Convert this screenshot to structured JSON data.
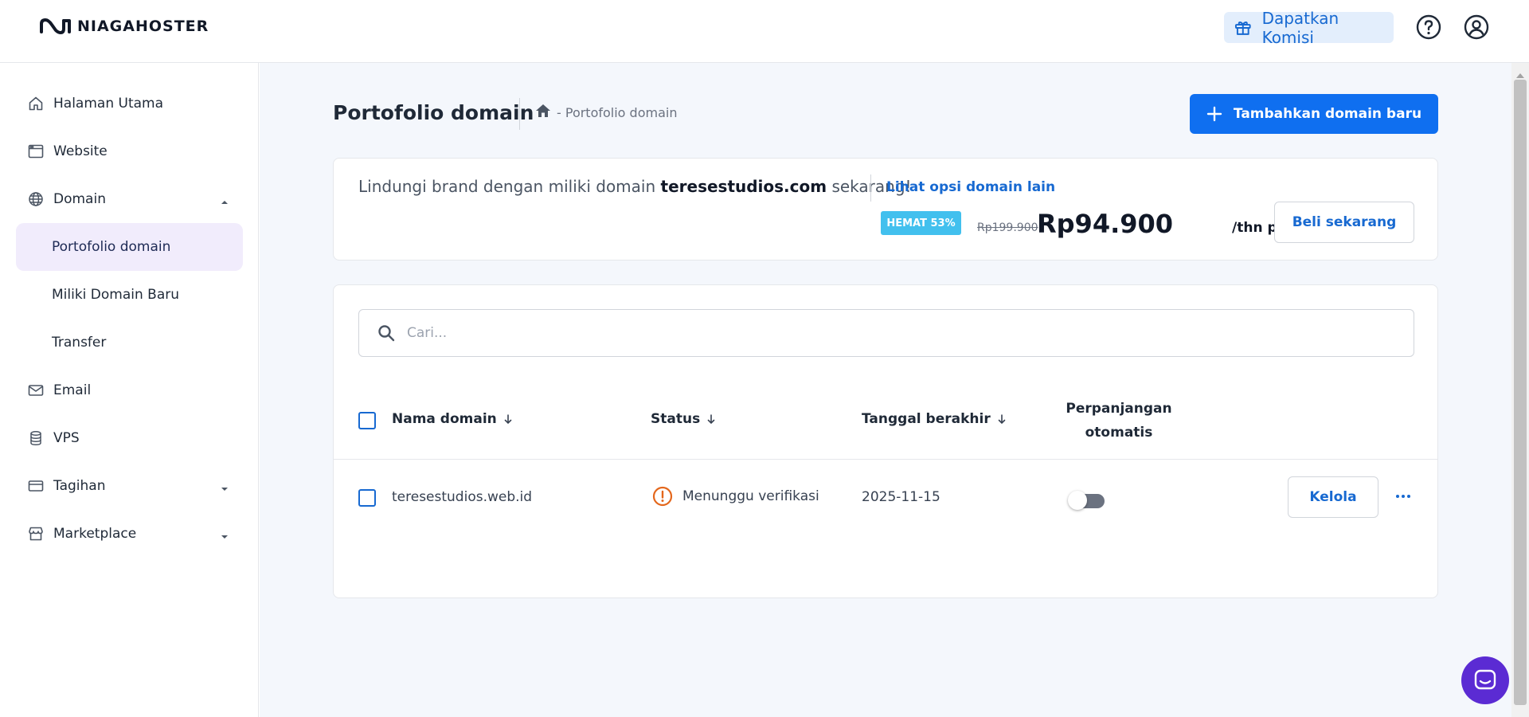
{
  "header": {
    "brand": "NIAGAHOSTER",
    "commission_label": "Dapatkan Komisi"
  },
  "sidebar": {
    "items": [
      {
        "label": "Halaman Utama",
        "icon": "home-icon"
      },
      {
        "label": "Website",
        "icon": "browser-icon"
      },
      {
        "label": "Domain",
        "icon": "globe-icon"
      },
      {
        "label": "Portofolio domain"
      },
      {
        "label": "Miliki Domain Baru"
      },
      {
        "label": "Transfer"
      },
      {
        "label": "Email",
        "icon": "mail-icon"
      },
      {
        "label": "VPS",
        "icon": "database-icon"
      },
      {
        "label": "Tagihan",
        "icon": "card-icon"
      },
      {
        "label": "Marketplace",
        "icon": "store-icon"
      }
    ],
    "active": "Portofolio domain"
  },
  "main": {
    "title": "Portofolio domain",
    "breadcrumb": "- Portofolio domain",
    "add_button": "Tambahkan domain baru"
  },
  "promo": {
    "text_before": "Lindungi brand dengan miliki domain ",
    "domain": "teresestudios.com",
    "text_after": " sekarang!",
    "link": "Lihat opsi domain lain",
    "badge": "HEMAT 53%",
    "old_price": "Rp199.900",
    "new_price": "Rp94.900",
    "period": "/thn pertama",
    "buy_button": "Beli sekarang"
  },
  "table": {
    "search_placeholder": "Cari...",
    "columns": {
      "domain": "Nama domain",
      "status": "Status",
      "end_date": "Tanggal berakhir",
      "auto_renew_line1": "Perpanjangan",
      "auto_renew_line2": "otomatis"
    },
    "rows": [
      {
        "domain": "teresestudios.web.id",
        "status": "Menunggu verifikasi",
        "end_date": "2025-11-15",
        "auto_renew": false,
        "action": "Kelola"
      }
    ]
  },
  "colors": {
    "primary": "#0f6ff0",
    "link": "#1769d1",
    "badge": "#42c0ee",
    "warning": "#e4671c",
    "active_bg": "#f1ecfc",
    "chat": "#5b2bd3"
  }
}
